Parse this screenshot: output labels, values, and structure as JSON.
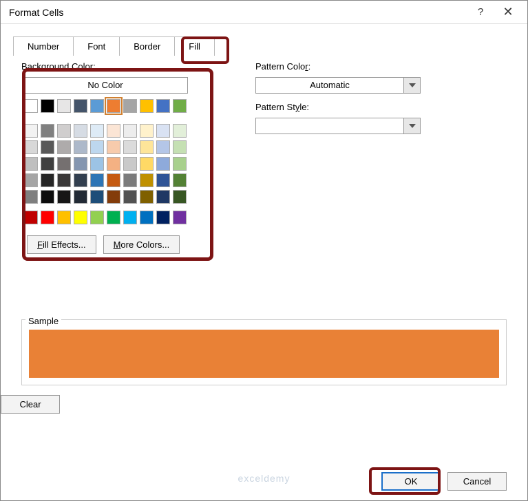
{
  "window": {
    "title": "Format Cells"
  },
  "tabs": [
    "Number",
    "Font",
    "Border",
    "Fill"
  ],
  "active_tab": 3,
  "labels": {
    "bg_color_pre": "Background ",
    "bg_color_u": "C",
    "bg_color_post": "olor:",
    "no_color": "No Color",
    "fill_effects_u": "F",
    "fill_effects_rest": "ill Effects...",
    "more_colors_u": "M",
    "more_colors_rest": "ore Colors...",
    "pattern_color_pre": "Pattern Colo",
    "pattern_color_u": "r",
    "pattern_color_post": ":",
    "pattern_style_pre": "Pattern St",
    "pattern_style_u": "y",
    "pattern_style_post": "le:",
    "sample": "Sample",
    "clear": "Clear",
    "ok": "OK",
    "cancel": "Cancel",
    "automatic": "Automatic"
  },
  "selected_color": "#e98136",
  "theme_row1": [
    "#ffffff",
    "#000000",
    "#e7e6e6",
    "#44546a",
    "#5b9bd5",
    "#ed7d31",
    "#a5a5a5",
    "#ffc000",
    "#4472c4",
    "#70ad47"
  ],
  "theme_shades": [
    [
      "#f2f2f2",
      "#808080",
      "#d0cece",
      "#d6dce4",
      "#deebf6",
      "#fbe5d5",
      "#ededed",
      "#fff2cc",
      "#d9e2f3",
      "#e2efd9"
    ],
    [
      "#d8d8d8",
      "#595959",
      "#aeabab",
      "#adb9ca",
      "#bdd7ee",
      "#f7cbac",
      "#dbdbdb",
      "#fee599",
      "#b4c6e7",
      "#c5e0b3"
    ],
    [
      "#bfbfbf",
      "#3f3f3f",
      "#757070",
      "#8496b0",
      "#9cc3e5",
      "#f4b183",
      "#c9c9c9",
      "#ffd965",
      "#8eaadb",
      "#a8d08d"
    ],
    [
      "#a5a5a5",
      "#262626",
      "#3a3838",
      "#323f4f",
      "#2e75b5",
      "#c55a11",
      "#7b7b7b",
      "#bf9000",
      "#2f5496",
      "#538135"
    ],
    [
      "#7f7f7f",
      "#0c0c0c",
      "#171616",
      "#222a35",
      "#1e4e79",
      "#833c0b",
      "#525252",
      "#7f6000",
      "#1f3864",
      "#375623"
    ]
  ],
  "standard_colors": [
    "#c00000",
    "#ff0000",
    "#ffc000",
    "#ffff00",
    "#92d050",
    "#00b050",
    "#00b0f0",
    "#0070c0",
    "#002060",
    "#7030a0"
  ],
  "watermark": "exceldemy"
}
